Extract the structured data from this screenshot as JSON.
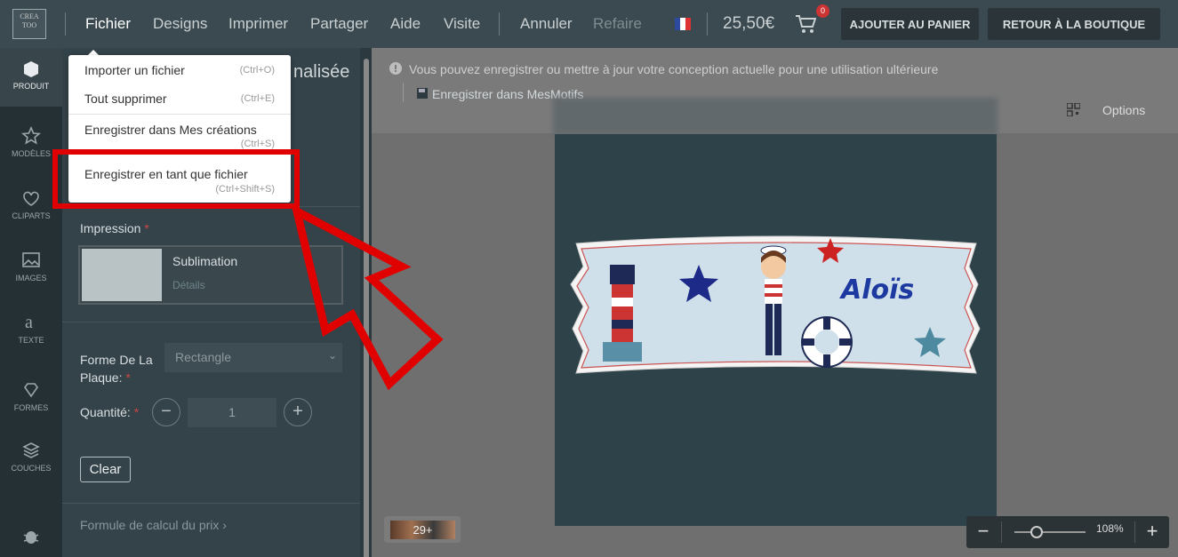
{
  "topbar": {
    "logo_lines": [
      "CREA",
      "TOO"
    ],
    "menu": [
      "Fichier",
      "Designs",
      "Imprimer",
      "Partager",
      "Aide",
      "Visite"
    ],
    "undo": "Annuler",
    "redo": "Refaire",
    "flag": "french-flag-icon",
    "price": "25,50€",
    "cart_count": "0",
    "add_to_cart": "AJOUTER AU PANIER",
    "back_to_shop": "RETOUR À LA BOUTIQUE"
  },
  "sidebar": {
    "items": [
      "PRODUIT",
      "MODÈLES",
      "CLIPARTS",
      "IMAGES",
      "TEXTE",
      "FORMES",
      "COUCHES"
    ]
  },
  "panel": {
    "title_fragment": "nalisée",
    "print_label": "Impression",
    "print_option": "Sublimation",
    "print_details": "Détails",
    "shape_label": "Forme De La Plaque:",
    "shape_value": "Rectangle",
    "qty_label": "Quantité:",
    "qty_value": "1",
    "clear": "Clear",
    "price_formula": "Formule de calcul du prix"
  },
  "dropdown": {
    "items": [
      {
        "label": "Importer un fichier",
        "shortcut": "(Ctrl+O)"
      },
      {
        "label": "Tout supprimer",
        "shortcut": "(Ctrl+E)"
      },
      {
        "label": "Enregistrer dans Mes créations",
        "shortcut": "(Ctrl+S)"
      },
      {
        "label": "Enregistrer en tant que fichier",
        "shortcut": "(Ctrl+Shift+S)"
      }
    ]
  },
  "workspace": {
    "info": "Vous pouvez enregistrer ou mettre à jour votre conception actuelle pour une utilisation ultérieure",
    "save_link": "Enregistrer dans MesMotifs",
    "options": "Options",
    "design_name": "Aloïs",
    "palette_count": "29+",
    "zoom": "108%"
  },
  "colors": {
    "accent_red": "#e00000",
    "topbar": "#3b4a50",
    "panel": "#34434a"
  }
}
